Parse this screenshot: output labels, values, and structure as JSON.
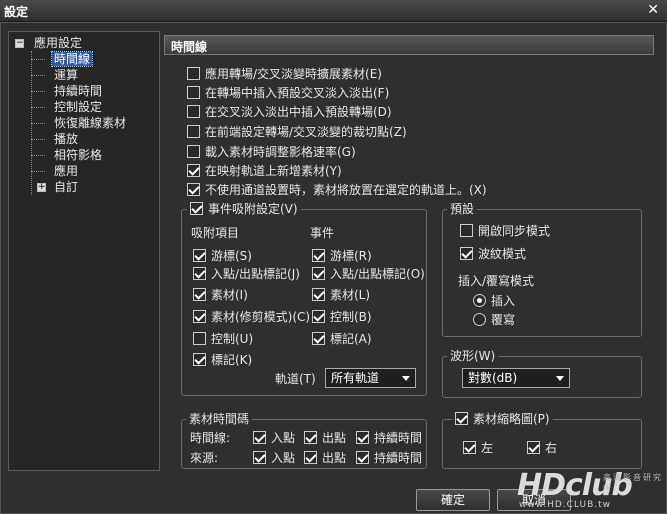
{
  "window": {
    "title": "設定"
  },
  "tree": {
    "root": "應用設定",
    "items": [
      "時間線",
      "運算",
      "持續時間",
      "控制設定",
      "恢復離線素材",
      "播放",
      "相符影格",
      "應用"
    ],
    "collapsed": "自訂"
  },
  "section_title": "時間線",
  "options": [
    {
      "label": "應用轉場/交叉淡變時擴展素材(E)",
      "checked": false
    },
    {
      "label": "在轉場中插入預設交叉淡入淡出(F)",
      "checked": false
    },
    {
      "label": "在交叉淡入淡出中插入預設轉場(D)",
      "checked": false
    },
    {
      "label": "在前端設定轉場/交叉淡變的裁切點(Z)",
      "checked": false
    },
    {
      "label": "載入素材時調整影格速率(G)",
      "checked": false
    },
    {
      "label": "在映射軌道上新增素材(Y)",
      "checked": true
    },
    {
      "label": "不使用通道設置時，素材將放置在選定的軌道上。(X)",
      "checked": true
    }
  ],
  "snap": {
    "title": "事件吸附設定(V)",
    "checked": true,
    "col1_header": "吸附項目",
    "col2_header": "事件",
    "col1": [
      {
        "label": "游標(S)",
        "checked": true
      },
      {
        "label": "入點/出點標記(J)",
        "checked": true
      },
      {
        "label": "素材(I)",
        "checked": true
      },
      {
        "label": "素材(修剪模式)(C)",
        "checked": true
      },
      {
        "label": "控制(U)",
        "checked": false
      },
      {
        "label": "標記(K)",
        "checked": true
      }
    ],
    "col2": [
      {
        "label": "游標(R)",
        "checked": true
      },
      {
        "label": "入點/出點標記(O)",
        "checked": true
      },
      {
        "label": "素材(L)",
        "checked": true
      },
      {
        "label": "控制(B)",
        "checked": true
      },
      {
        "label": "標記(A)",
        "checked": true
      }
    ],
    "track_label": "軌道(T)",
    "track_value": "所有軌道"
  },
  "preset": {
    "title": "預設",
    "sync": {
      "label": "開啟同步模式",
      "checked": false
    },
    "ripple": {
      "label": "波紋模式",
      "checked": true
    },
    "mode_title": "插入/覆寫模式",
    "insert": {
      "label": "插入",
      "checked": true
    },
    "overwrite": {
      "label": "覆寫",
      "checked": false
    }
  },
  "waveform": {
    "title": "波形(W)",
    "value": "對數(dB)"
  },
  "clip_timecode": {
    "title": "素材時間碼",
    "rows": [
      {
        "label": "時間線:",
        "in": "入點",
        "out": "出點",
        "dur": "持續時間"
      },
      {
        "label": "來源:",
        "in": "入點",
        "out": "出點",
        "dur": "持續時間"
      }
    ]
  },
  "thumbnail": {
    "title": "素材縮略圖(P)",
    "checked": true,
    "left": "左",
    "right": "右"
  },
  "buttons": {
    "ok": "確定",
    "cancel": "取消"
  },
  "watermark": {
    "logo": "HDclub",
    "sub": "高清影音研究所",
    "url": "www.HD.CLUB.tw"
  }
}
